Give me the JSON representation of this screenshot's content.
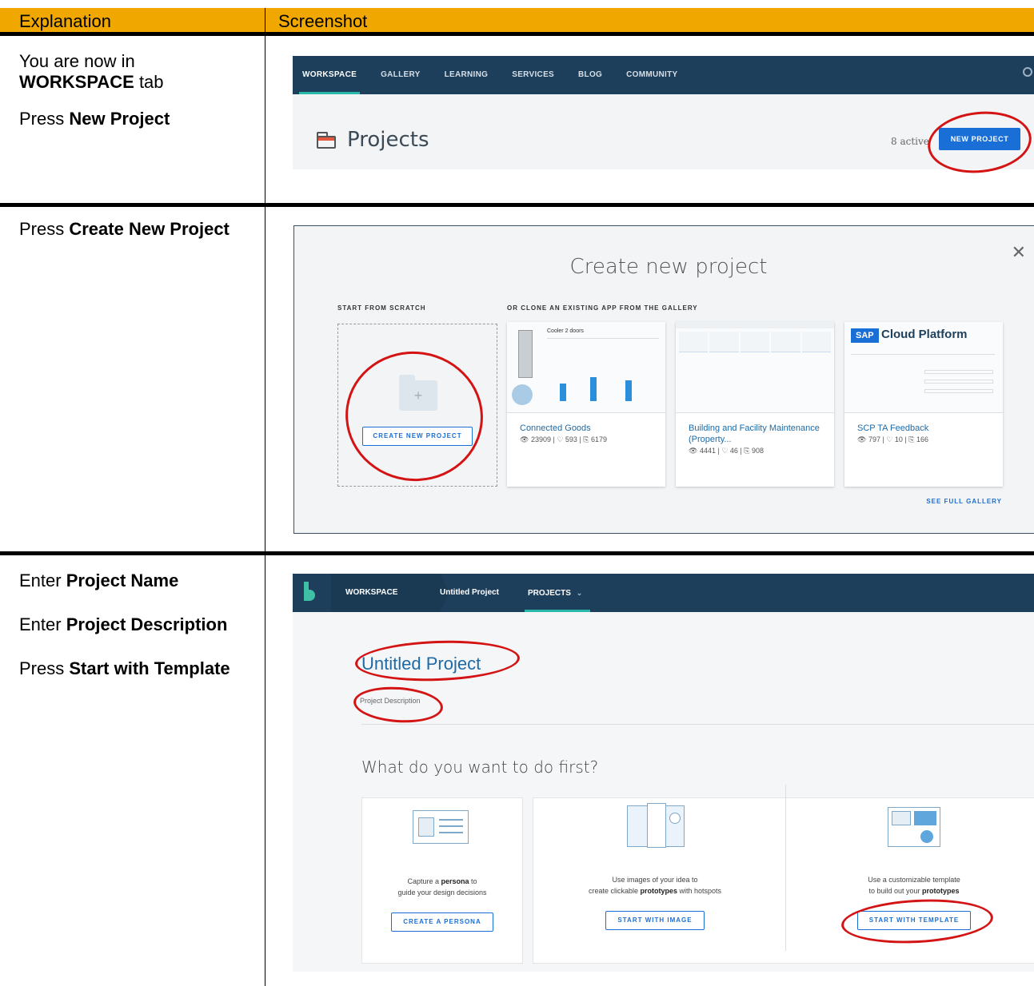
{
  "header": {
    "col1": "Explanation",
    "col2": "Screenshot"
  },
  "rows": [
    {
      "expl": [
        {
          "pre": "You are now in ",
          "bold": "WORKSPACE",
          "post": " tab"
        },
        {
          "pre": "Press ",
          "bold": "New Project",
          "post": ""
        }
      ]
    },
    {
      "expl": [
        {
          "pre": "Press ",
          "bold": "Create New Project",
          "post": ""
        }
      ]
    },
    {
      "expl": [
        {
          "pre": "Enter ",
          "bold": "Project Name",
          "post": ""
        },
        {
          "pre": "Enter ",
          "bold": "Project Description",
          "post": ""
        },
        {
          "pre": "Press ",
          "bold": "Start with Template",
          "post": ""
        }
      ]
    }
  ],
  "shot1": {
    "nav": [
      "WORKSPACE",
      "GALLERY",
      "LEARNING",
      "SERVICES",
      "BLOG",
      "COMMUNITY"
    ],
    "title": "Projects",
    "active": "8 active",
    "button": "NEW PROJECT"
  },
  "shot2": {
    "title": "Create new project",
    "left_label": "START FROM SCRATCH",
    "right_label": "OR CLONE AN EXISTING APP FROM THE GALLERY",
    "create_button": "CREATE NEW PROJECT",
    "see_full": "SEE FULL GALLERY",
    "close_icon": "close-icon",
    "cards": [
      {
        "name": "Connected Goods",
        "views": "23909",
        "likes": "593",
        "clones": "6179"
      },
      {
        "name": "Building and Facility Maintenance (Property...",
        "views": "4441",
        "likes": "46",
        "clones": "908"
      },
      {
        "name": "SCP TA Feedback",
        "views": "797",
        "likes": "10",
        "clones": "166"
      }
    ],
    "card1_thumb": {
      "heading": "Cooler 2 doors"
    },
    "card3_thumb": {
      "logo": "SAP",
      "brand": "Cloud Platform"
    }
  },
  "shot3": {
    "nav": {
      "workspace": "WORKSPACE",
      "project": "Untitled Project",
      "projects": "PROJECTS",
      "chevron": "⌄"
    },
    "project_name": "Untitled Project",
    "project_desc": "Project Description",
    "question": "What do you want to do first?",
    "options": [
      {
        "line1a": "Capture a ",
        "line1b": "persona",
        "line1c": " to",
        "line2a": "guide your design decisions",
        "line2b": "",
        "button": "CREATE A PERSONA"
      },
      {
        "line1a": "Use images of your idea to",
        "line1b": "",
        "line1c": "",
        "line2a": "create clickable ",
        "line2b": "prototypes",
        "line2c": " with hotspots",
        "button": "START WITH IMAGE"
      },
      {
        "line1a": "Use a customizable template",
        "line1b": "",
        "line1c": "",
        "line2a": "to build out your ",
        "line2b": "prototypes",
        "line2c": "",
        "button": "START WITH TEMPLATE"
      }
    ]
  },
  "colors": {
    "header_bg": "#f0a800",
    "nav_bg": "#1e3f5b",
    "accent": "#1a6fd6",
    "annotation": "#d41414"
  }
}
